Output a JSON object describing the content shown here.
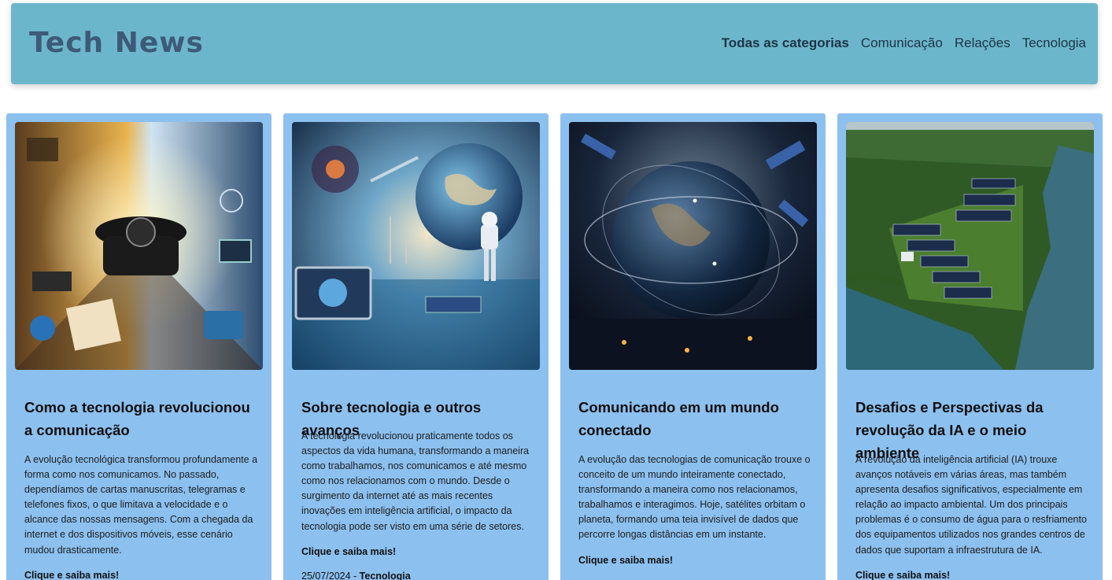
{
  "header": {
    "brand": "Tech News",
    "nav": [
      "Todas as categorias",
      "Comunicação",
      "Relações",
      "Tecnologia"
    ]
  },
  "cards": [
    {
      "title": "Como a tecnologia revolucionou a comunicação",
      "description": "A evolução tecnológica transformou profundamente a forma como nos comunicamos. No passado, dependíamos de cartas manuscritas, telegramas e telefones fixos, o que limitava a velocidade e o alcance das nossas mensagens. Com a chegada da internet e dos dispositivos móveis, esse cenário mudou drasticamente.",
      "more": "Clique e saiba mais!"
    },
    {
      "title": "Sobre tecnologia e outros avanços",
      "description": "A tecnologia revolucionou praticamente todos os aspectos da vida humana, transformando a maneira como trabalhamos, nos comunicamos e até mesmo como nos relacionamos com o mundo. Desde o surgimento da internet até as mais recentes inovações em inteligência artificial, o impacto da tecnologia pode ser visto em uma série de setores.",
      "more": "Clique e saiba mais!",
      "date": "25/07/2024",
      "separator": " - ",
      "category": "Tecnologia"
    },
    {
      "title": "Comunicando em um mundo conectado",
      "description": "A evolução das tecnologias de comunicação trouxe o conceito de um mundo inteiramente conectado, transformando a maneira como nos relacionamos, trabalhamos e interagimos. Hoje, satélites orbitam o planeta, formando uma teia invisível de dados que percorre longas distâncias em um instante.",
      "more": "Clique e saiba mais!"
    },
    {
      "title": "Desafios e Perspectivas da revolução da IA e o meio ambiente",
      "description": "A revolução da inteligência artificial (IA) trouxe avanços notáveis em várias áreas, mas também apresenta desafios significativos, especialmente em relação ao impacto ambiental. Um dos principais problemas é o consumo de água para o resfriamento dos equipamentos utilizados nos grandes centros de dados que suportam a infraestrutura de IA.",
      "more": "Clique e saiba mais!"
    }
  ],
  "colors": {
    "header_bg": "#6cb6cb",
    "brand": "#3d5a78",
    "card_bg": "#8cc0ef"
  }
}
